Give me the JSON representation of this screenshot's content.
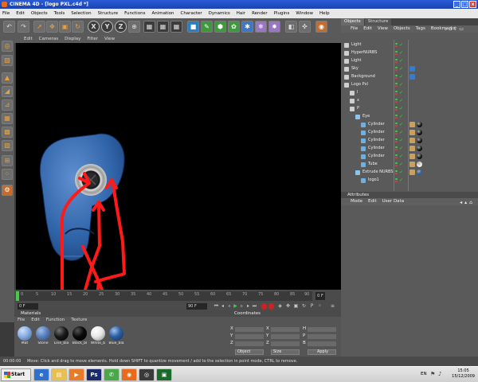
{
  "window": {
    "title": "CINEMA 4D - [logo PXL.c4d *]",
    "min": "_",
    "max": "□",
    "close": "x"
  },
  "menubar": [
    "File",
    "Edit",
    "Objects",
    "Tools",
    "Selection",
    "Structure",
    "Functions",
    "Animation",
    "Character",
    "Dynamics",
    "Hair",
    "Render",
    "Plugins",
    "Window",
    "Help"
  ],
  "toolbar": {
    "axis_x": "X",
    "axis_y": "Y",
    "axis_z": "Z"
  },
  "viewport": {
    "menu": [
      "Edit",
      "Cameras",
      "Display",
      "Filter",
      "View"
    ]
  },
  "objects_panel": {
    "tabs": [
      "Objects",
      "Structure"
    ],
    "menu": [
      "File",
      "Edit",
      "View",
      "Objects",
      "Tags",
      "Bookmarks"
    ],
    "rows": [
      {
        "name": "Light",
        "indent": 0,
        "tags": []
      },
      {
        "name": "HyperNURBS",
        "indent": 0,
        "tags": []
      },
      {
        "name": "Light",
        "indent": 0,
        "tags": []
      },
      {
        "name": "Sky",
        "indent": 0,
        "tags": [
          "texture-blue"
        ]
      },
      {
        "name": "Background",
        "indent": 0,
        "tags": [
          "texture-blue"
        ]
      },
      {
        "name": "Logo Pxl",
        "indent": 0,
        "tags": []
      },
      {
        "name": "l",
        "indent": 1,
        "tags": []
      },
      {
        "name": "x",
        "indent": 1,
        "tags": []
      },
      {
        "name": "P",
        "indent": 1,
        "tags": []
      },
      {
        "name": "Eye",
        "indent": 2,
        "tags": []
      },
      {
        "name": "Cylinder",
        "indent": 3,
        "tags": [
          "phong",
          "black"
        ]
      },
      {
        "name": "Cylinder",
        "indent": 3,
        "tags": [
          "phong",
          "black"
        ]
      },
      {
        "name": "Cylinder",
        "indent": 3,
        "tags": [
          "phong",
          "black"
        ]
      },
      {
        "name": "Cylinder",
        "indent": 3,
        "tags": [
          "phong",
          "black"
        ]
      },
      {
        "name": "Cylinder",
        "indent": 3,
        "tags": [
          "phong",
          "black"
        ]
      },
      {
        "name": "Tube",
        "indent": 3,
        "tags": [
          "phong",
          "white"
        ]
      },
      {
        "name": "Extrude NURBS",
        "indent": 2,
        "tags": [
          "phong",
          "blue"
        ]
      },
      {
        "name": "logo1",
        "indent": 3,
        "tags": []
      }
    ]
  },
  "attributes_panel": {
    "title": "Attributes",
    "menu": [
      "Mode",
      "Edit",
      "User Data"
    ]
  },
  "timeline": {
    "ticks": [
      "0",
      "5",
      "10",
      "15",
      "20",
      "25",
      "30",
      "35",
      "40",
      "45",
      "50",
      "55",
      "60",
      "65",
      "70",
      "75",
      "80",
      "85",
      "90"
    ],
    "end_frame": "0 F",
    "start_field": "0 F",
    "range_field": "90 F"
  },
  "materials": {
    "title": "Materials",
    "menu": [
      "File",
      "Edit",
      "Function",
      "Texture"
    ],
    "items": [
      {
        "name": "Mat",
        "color": "#8aaee0"
      },
      {
        "name": "Stone",
        "color": "#5a7fb8"
      },
      {
        "name": "Line_bla",
        "color": "#1a1a1a"
      },
      {
        "name": "Black_bl",
        "color": "#0a0a0a"
      },
      {
        "name": "White_b",
        "color": "#e8e8e8"
      },
      {
        "name": "Blue_bla",
        "color": "#2d5ea0"
      }
    ]
  },
  "coordinates": {
    "title": "Coordinates",
    "axes": [
      "X",
      "Y",
      "Z"
    ],
    "size_axes": [
      "X",
      "Y",
      "Z"
    ],
    "rot_axes": [
      "H",
      "P",
      "B"
    ],
    "dropdown1": "Object",
    "dropdown2": "Size",
    "apply": "Apply"
  },
  "statusbar": {
    "time": "00:00:00",
    "message": "Move: Click and drag to move elements. Hold down SHIFT to quantize movement / add to the selection in point mode, CTRL to remove."
  },
  "taskbar": {
    "start": "Start",
    "lang": "EN",
    "time": "15:05",
    "date": "15/12/2009"
  },
  "colors": {
    "accent": "#e8a040",
    "annotation_red": "#ff1a1a",
    "logo_blue": "#2f63a8"
  }
}
